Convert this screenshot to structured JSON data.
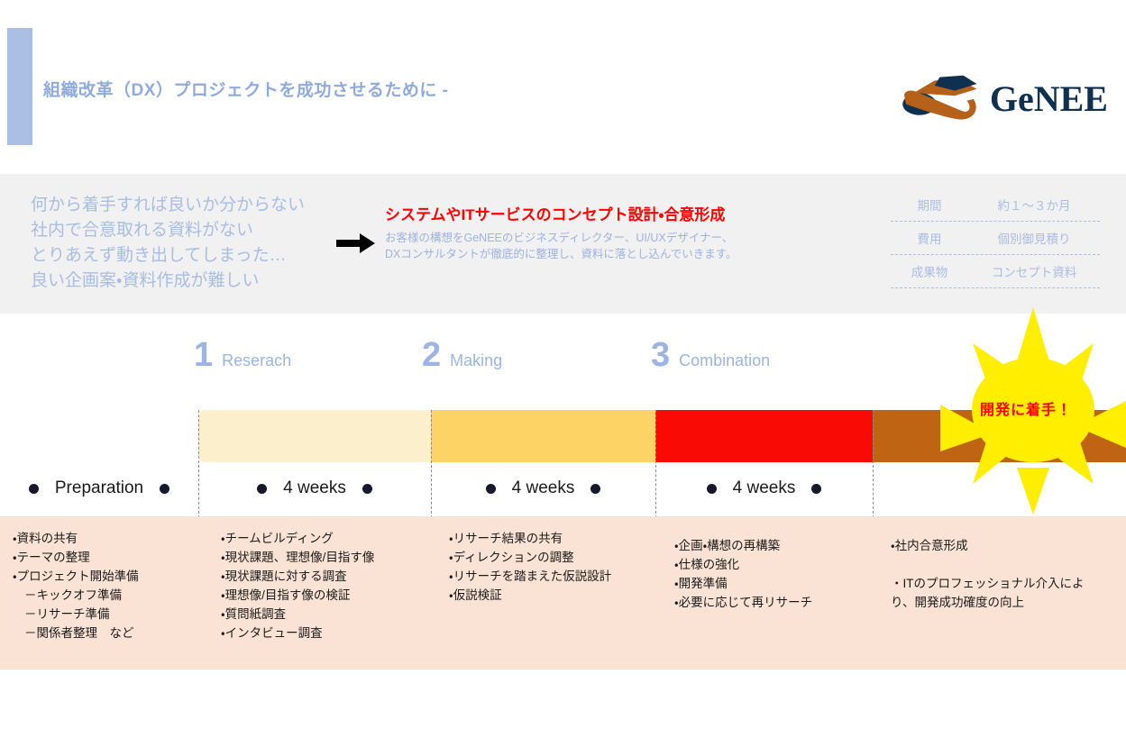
{
  "header": {
    "title": "組織改革（DX）プロジェクトを成功させるために -",
    "logo_text": "GeNEE",
    "accent_color": "#aabfe3",
    "logo_navy": "#10304f",
    "logo_orange": "#b5611a"
  },
  "band": {
    "problems": [
      "何から着手すれば良いか分からない",
      "社内で合意取れる資料がない",
      "とりあえず動き出してしまった…",
      "良い企画案・資料作成が難しい"
    ],
    "solution_title": "システムやITサービスのコンセプト設計・合意形成",
    "solution_desc": [
      "お客様の構想をGeNEEのビジネスディレクター、UI/UXデザイナー、",
      "DXコンサルタントが徹底的に整理し、資料に落とし込んでいきます。"
    ],
    "info": [
      {
        "label": "期間",
        "value": "約１〜３か月"
      },
      {
        "label": "費用",
        "value": "個別御見積り"
      },
      {
        "label": "成果物",
        "value": "コンセプト資料"
      }
    ],
    "arrow_color": "#000000",
    "title_color": "#ff0000",
    "text_color": "#a8bde2"
  },
  "phases": [
    {
      "number": "1",
      "name": "Reserach"
    },
    {
      "number": "2",
      "name": "Making"
    },
    {
      "number": "3",
      "name": "Combination"
    }
  ],
  "bars": [
    {
      "color": "#fcefcb"
    },
    {
      "color": "#fdd366"
    },
    {
      "color": "#fa0a05"
    },
    {
      "color": "#bf6412"
    }
  ],
  "weeks": [
    {
      "label": "Preparation"
    },
    {
      "label": "4 weeks"
    },
    {
      "label": "4 weeks"
    },
    {
      "label": "4 weeks"
    },
    {
      "label": ""
    }
  ],
  "columns": [
    {
      "items": [
        {
          "text": "・資料の共有",
          "level": 0
        },
        {
          "text": "・テーマの整理",
          "level": 0
        },
        {
          "text": "・プロジェクト開始準備",
          "level": 0
        },
        {
          "text": "－キックオフ準備",
          "level": 1
        },
        {
          "text": "－リサーチ準備",
          "level": 1
        },
        {
          "text": "－関係者整理　など",
          "level": 1
        }
      ]
    },
    {
      "items": [
        {
          "text": "・チームビルディング",
          "level": 0
        },
        {
          "text": "・現状課題、理想像/目指す像",
          "level": 0
        },
        {
          "text": "・現状課題に対する調査",
          "level": 0
        },
        {
          "text": "・理想像/目指す像の検証",
          "level": 0
        },
        {
          "text": "・質問紙調査",
          "level": 0
        },
        {
          "text": "・インタビュー調査",
          "level": 0
        }
      ]
    },
    {
      "items": [
        {
          "text": "・リサーチ結果の共有",
          "level": 0
        },
        {
          "text": "・ディレクションの調整",
          "level": 0
        },
        {
          "text": "・リサーチを踏まえた仮説設計",
          "level": 0
        },
        {
          "text": "・仮説検証",
          "level": 0
        }
      ]
    },
    {
      "items": [
        {
          "text": "・企画・構想の再構築",
          "level": 0
        },
        {
          "text": "・仕様の強化",
          "level": 0
        },
        {
          "text": "・開発準備",
          "level": 0
        },
        {
          "text": "・必要に応じて再リサーチ",
          "level": 0
        }
      ]
    },
    {
      "items": [
        {
          "text": "・社内合意形成",
          "level": 0
        },
        {
          "text": "・ITのプロフェッショナル介入により、開発成功確度の向上",
          "level": 2
        }
      ]
    }
  ],
  "badge": {
    "text": "開発に着手！",
    "fill": "#ffee00",
    "text_color": "#ff0000"
  },
  "panel_color": "#fae3d4"
}
